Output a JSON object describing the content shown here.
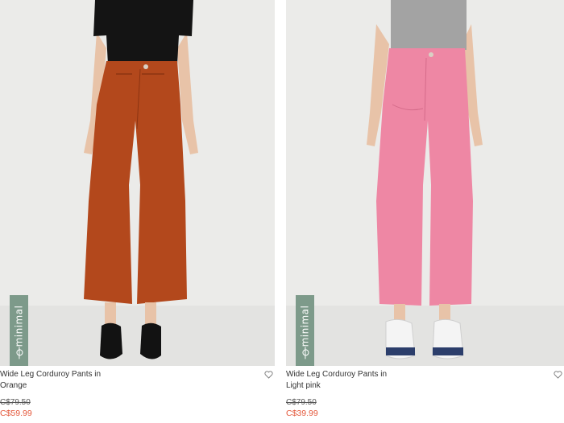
{
  "products": [
    {
      "badge": "minimal",
      "name_line1": "Wide Leg Corduroy Pants in",
      "name_line2": "Orange",
      "original_price": "C$79.50",
      "sale_price": "C$59.99",
      "pants_color": "#b3481c",
      "top_color": "#141414"
    },
    {
      "badge": "minimal",
      "name_line1": "Wide Leg Corduroy Pants in",
      "name_line2": "Light pink",
      "original_price": "C$79.50",
      "sale_price": "C$39.99",
      "pants_color": "#ee87a4",
      "top_color": "#a3a3a3"
    }
  ],
  "colors": {
    "badge": "#7d9a8a",
    "sale": "#e4583b",
    "photo_bg": "#ebebe9"
  }
}
